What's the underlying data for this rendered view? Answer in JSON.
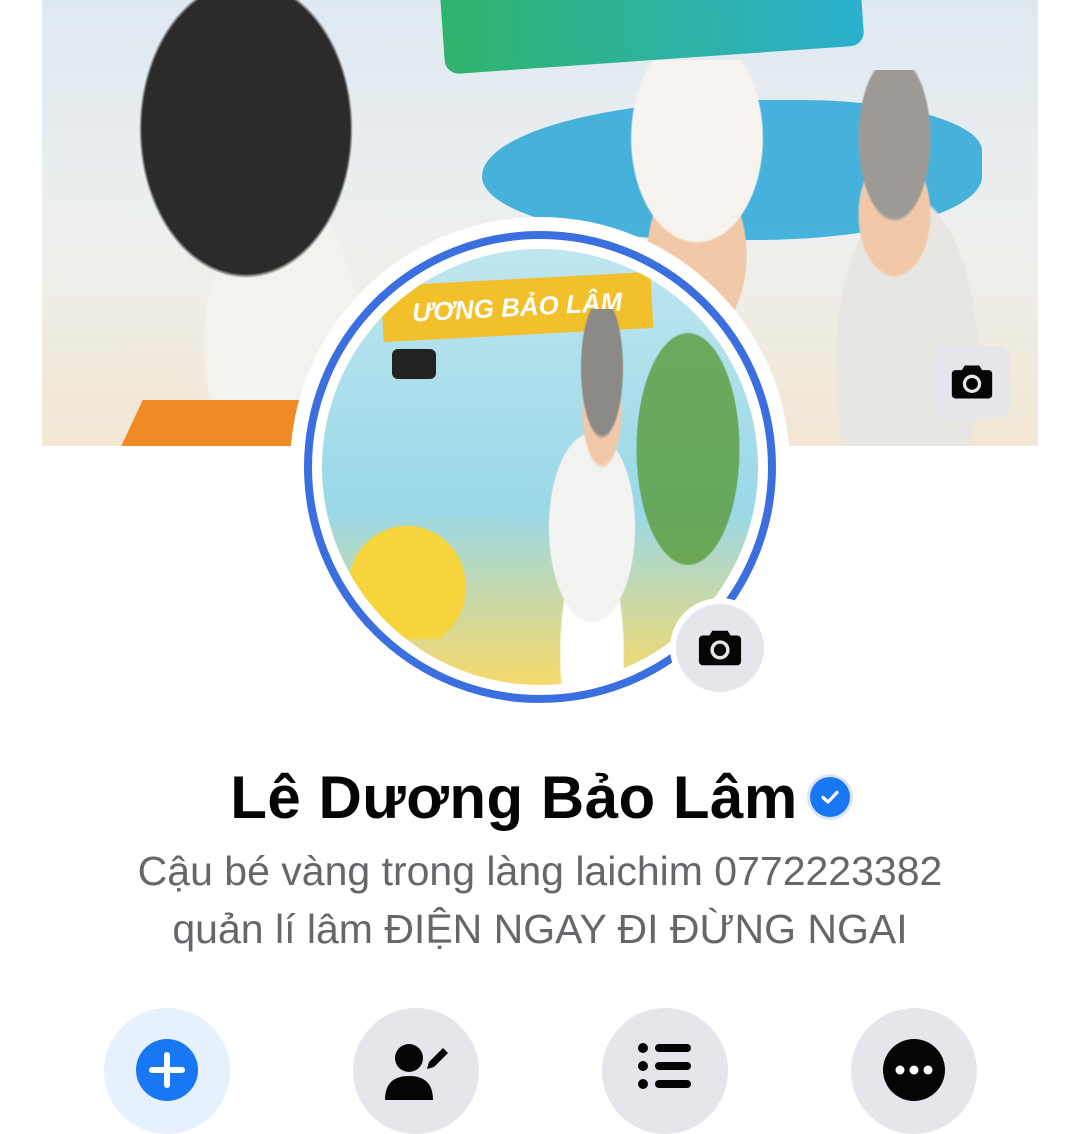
{
  "profile": {
    "name": "Lê Dương Bảo Lâm",
    "bio_line1": "Cậu bé vàng trong làng laichim 0772223382",
    "bio_line2": "quản lí lâm ĐIỆN NGAY ĐI ĐỪNG NGAI",
    "verified": true,
    "avatar_caption": "ƯƠNG BẢO LÂM"
  },
  "icons": {
    "cover_camera": "camera-icon",
    "avatar_camera": "camera-icon",
    "verified": "verified-check-icon",
    "add": "plus-icon",
    "edit": "edit-profile-icon",
    "list": "list-icon",
    "more": "more-dots-icon"
  },
  "colors": {
    "accent": "#1877f2",
    "avatar_ring": "#3b6fe0",
    "button_bg": "#e4e6eb",
    "text_primary": "#050505",
    "text_secondary": "#65676b"
  }
}
